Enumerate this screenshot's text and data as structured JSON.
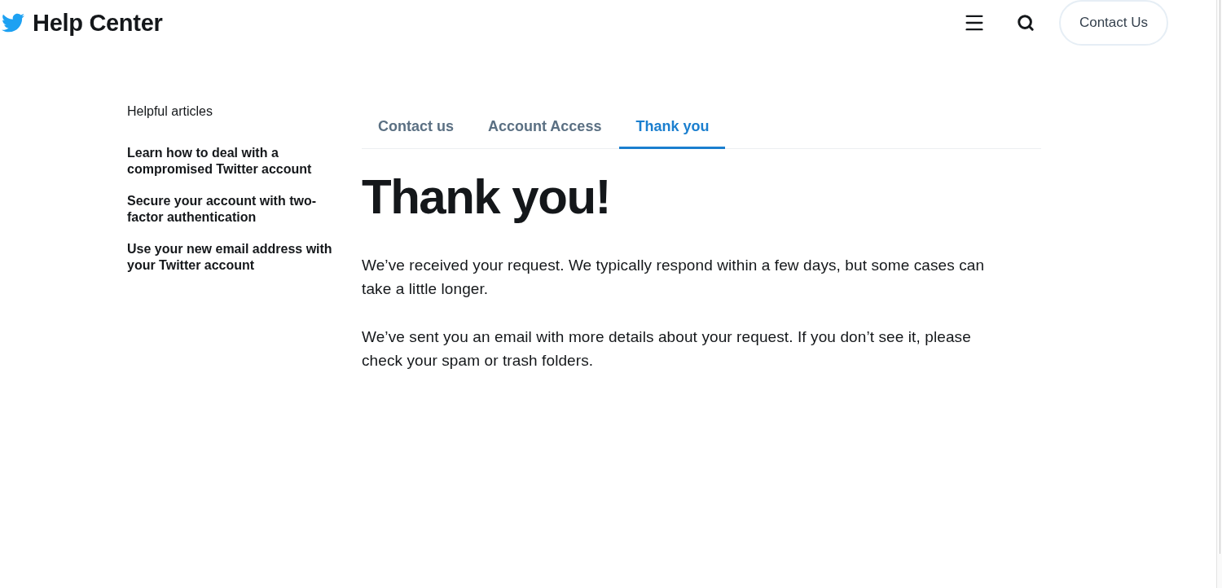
{
  "header": {
    "title": "Help Center",
    "contact_button": "Contact Us"
  },
  "sidebar": {
    "heading": "Helpful articles",
    "articles": [
      "Learn how to deal with a compromised Twitter account",
      "Secure your account with two-factor authentication",
      "Use your new email address with your Twitter account"
    ]
  },
  "tabs": [
    {
      "label": "Contact us",
      "selected": false
    },
    {
      "label": "Account Access",
      "selected": false
    },
    {
      "label": "Thank you",
      "selected": true
    }
  ],
  "heading": "Thank you!",
  "paragraphs": [
    "We’ve received your request. We typically respond within a few days, but some cases can take a little longer.",
    "We’ve sent you an email with more details about your request. If you don’t see it, please check your spam or trash folders."
  ]
}
